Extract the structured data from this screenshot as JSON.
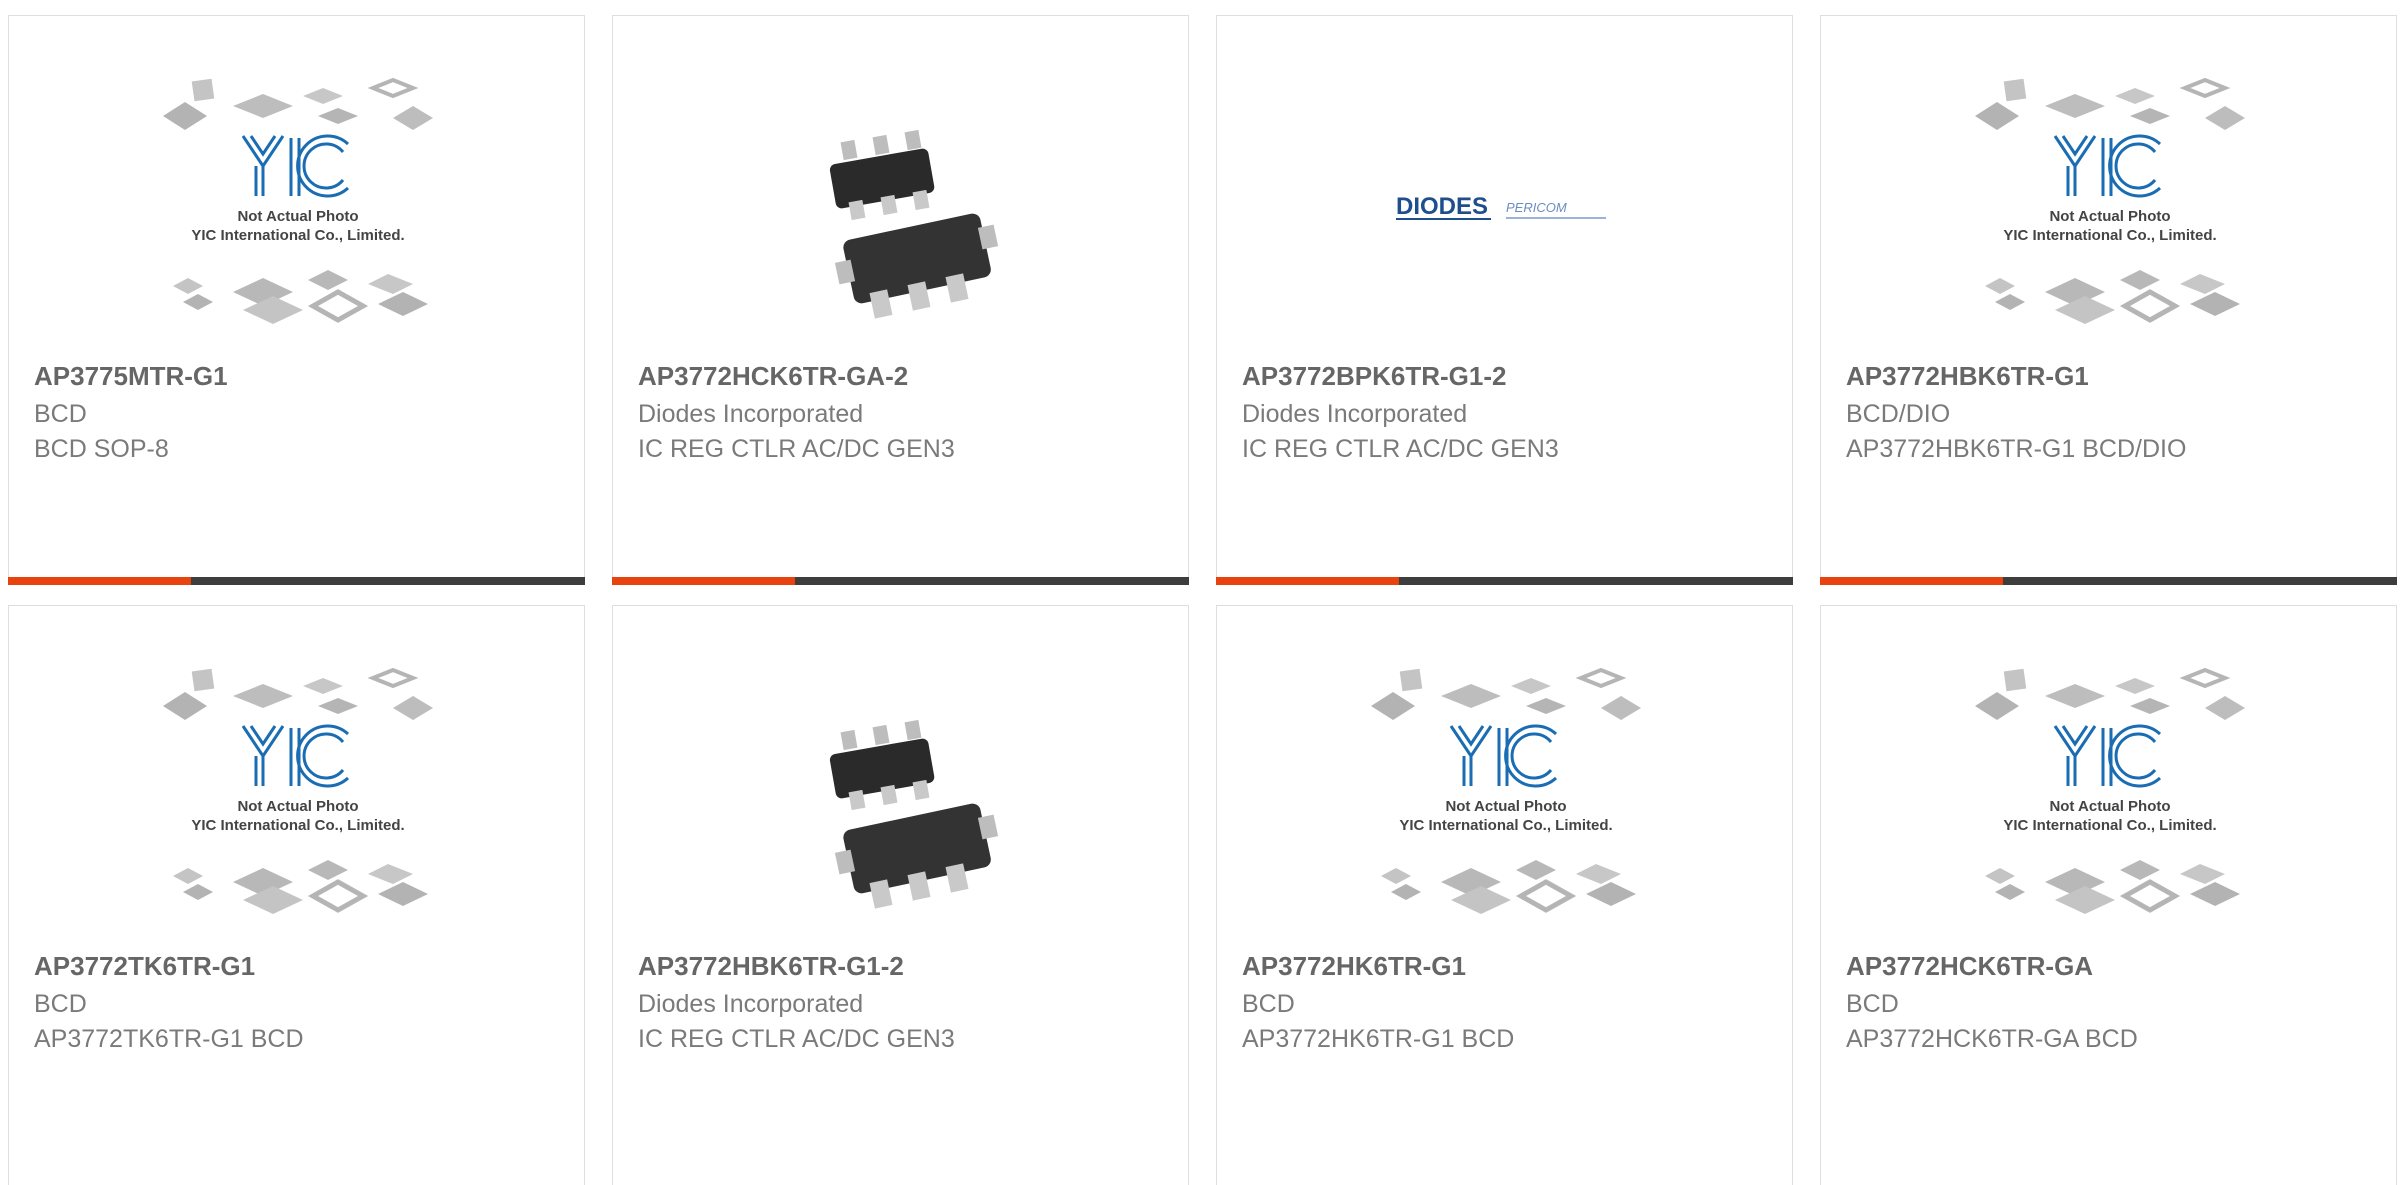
{
  "theme": {
    "accent": "#e8430f",
    "bar": "#3d3d3d",
    "yic_blue": "#1a6db3"
  },
  "yic_image": {
    "line1": "Not Actual Photo",
    "line2": "YIC International Co., Limited."
  },
  "diodes_logo": {
    "brand": "DIODES",
    "sub": "PERICOM"
  },
  "products": [
    {
      "part_number": "AP3775MTR-G1",
      "manufacturer": "BCD",
      "description": "BCD SOP-8",
      "image": "yic-placeholder"
    },
    {
      "part_number": "AP3772HCK6TR-GA-2",
      "manufacturer": "Diodes Incorporated",
      "description": "IC REG CTLR AC/DC GEN3",
      "image": "sot-chip"
    },
    {
      "part_number": "AP3772BPK6TR-G1-2",
      "manufacturer": "Diodes Incorporated",
      "description": "IC REG CTLR AC/DC GEN3",
      "image": "diodes-logo"
    },
    {
      "part_number": "AP3772HBK6TR-G1",
      "manufacturer": "BCD/DIO",
      "description": "AP3772HBK6TR-G1 BCD/DIO",
      "image": "yic-placeholder"
    },
    {
      "part_number": "AP3772TK6TR-G1",
      "manufacturer": "BCD",
      "description": "AP3772TK6TR-G1 BCD",
      "image": "yic-placeholder"
    },
    {
      "part_number": "AP3772HBK6TR-G1-2",
      "manufacturer": "Diodes Incorporated",
      "description": "IC REG CTLR AC/DC GEN3",
      "image": "sot-chip"
    },
    {
      "part_number": "AP3772HK6TR-G1",
      "manufacturer": "BCD",
      "description": "AP3772HK6TR-G1 BCD",
      "image": "yic-placeholder"
    },
    {
      "part_number": "AP3772HCK6TR-GA",
      "manufacturer": "BCD",
      "description": "AP3772HCK6TR-GA BCD",
      "image": "yic-placeholder"
    }
  ]
}
